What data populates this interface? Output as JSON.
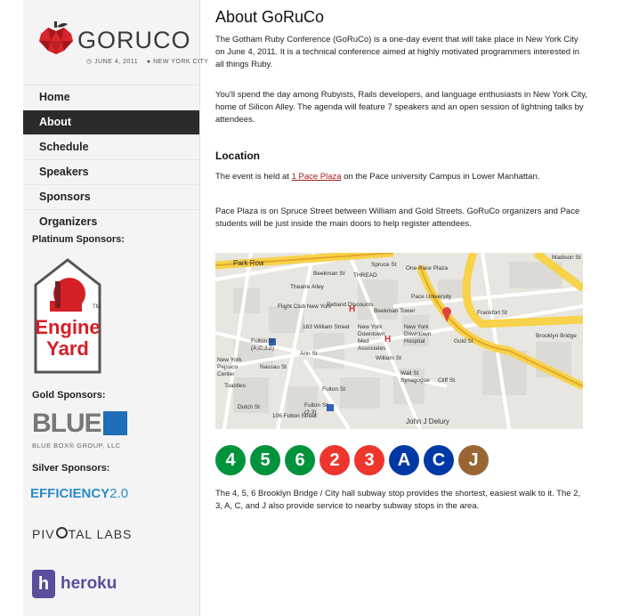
{
  "logo": {
    "name": "GORUCO",
    "date": "JUNE 4, 2011",
    "location": "NEW YORK CITY"
  },
  "nav": {
    "items": [
      {
        "label": "Home"
      },
      {
        "label": "About",
        "active": true
      },
      {
        "label": "Schedule"
      },
      {
        "label": "Speakers"
      },
      {
        "label": "Sponsors"
      },
      {
        "label": "Organizers"
      }
    ]
  },
  "sponsors": {
    "platinum_heading": "Platinum Sponsors:",
    "gold_heading": "Gold Sponsors:",
    "silver_heading": "Silver Sponsors:",
    "platinum": {
      "line1": "Engine",
      "line2": "Yard",
      "tm": "TM"
    },
    "gold": {
      "name": "BLUE",
      "sub": "BLUE BOX® GROUP, LLC"
    },
    "silver": [
      {
        "name": "EFFICIENCY",
        "version": "2.0"
      },
      {
        "pre": "PIV",
        "post": "TAL LABS"
      },
      {
        "name": "heroku",
        "glyph": "h"
      }
    ]
  },
  "main": {
    "title": "About GoRuCo",
    "intro": "The Gotham Ruby Conference (GoRuCo) is a one-day event that will take place in New York City on June 4, 2011. It is a technical conference aimed at highly motivated programmers interested in all things Ruby.",
    "spend": "You'll spend the day among Rubyists, Rails developers, and language enthusiasts in New York City, home of Silicon Alley. The agenda will feature 7 speakers and an open session of lightning talks by attendees.",
    "location_heading": "Location",
    "event_prefix": "The event is held at ",
    "event_link": "1 Pace Plaza",
    "event_suffix": " on the Pace university Campus in Lower Manhattan.",
    "pace_plaza": "Pace Plaza is on Spruce Street between William and Gold Streets. GoRuCo organizers and Pace students will be just inside the main doors to help register attendees.",
    "subway_text": "The 4, 5, 6 Brooklyn Bridge / City hall subway stop provides the shortest, easiest walk to it. The 2, 3, A, C, and J also provide service to nearby subway stops in the area."
  },
  "map": {
    "labels": [
      "Park Row",
      "Beekman St",
      "Spruce St",
      "One Pace Plaza",
      "Madison St",
      "Theatre Alley",
      "THREAD",
      "Pace University",
      "Flight Club New York",
      "Petland Discounts",
      "Beekman Tower",
      "163 William Street",
      "New York Downtown Med Associates",
      "New York Downtown Hospital",
      "Frankfort St",
      "Brooklyn Bridge",
      "Ann St",
      "Fulton St (A,C,J,Z)",
      "Fulton St (2,3)",
      "Nassau St",
      "William St",
      "Gold St",
      "Cliff St",
      "Wall St Synagogue",
      "Toasties",
      "106 Fulton Street",
      "Dutch St",
      "John J Delury",
      "New York Pepsico Center",
      "Fulton St"
    ]
  },
  "subway": [
    {
      "label": "4",
      "color": "#00933c"
    },
    {
      "label": "5",
      "color": "#00933c"
    },
    {
      "label": "6",
      "color": "#00933c"
    },
    {
      "label": "2",
      "color": "#ee352e"
    },
    {
      "label": "3",
      "color": "#ee352e"
    },
    {
      "label": "A",
      "color": "#0039a6"
    },
    {
      "label": "C",
      "color": "#0039a6"
    },
    {
      "label": "J",
      "color": "#996633"
    }
  ]
}
